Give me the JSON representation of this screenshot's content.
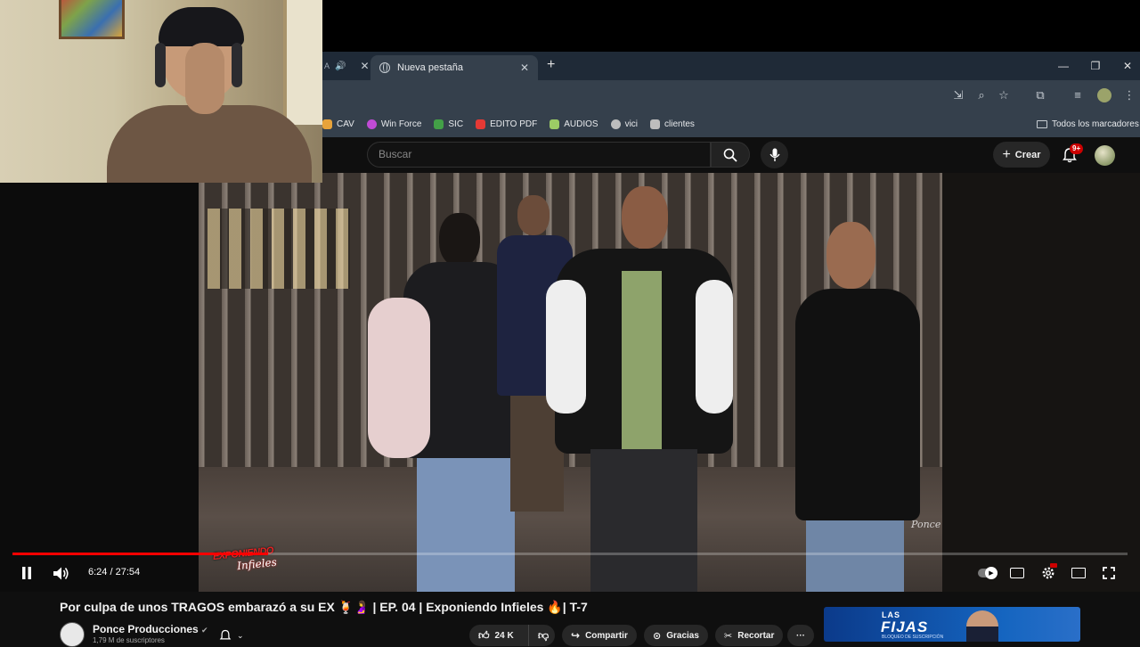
{
  "browser": {
    "prev_tab_label": "A",
    "active_tab_title": "Nueva pestaña",
    "new_tab_symbol": "+",
    "bookmarks": [
      {
        "label": "CAV",
        "color": "#e8a33a"
      },
      {
        "label": "Win Force",
        "color": "#c04bd6"
      },
      {
        "label": "SIC",
        "color": "#43a047"
      },
      {
        "label": "EDITO PDF",
        "color": "#e53935"
      },
      {
        "label": "AUDIOS",
        "color": "#9ccc65"
      },
      {
        "label": "vici",
        "color": "#bdbdbd"
      },
      {
        "label": "clientes",
        "color": "#bdbdbd"
      }
    ],
    "all_bookmarks_label": "Todos los marcadores"
  },
  "youtube": {
    "search_placeholder": "Buscar",
    "create_label": "Crear",
    "notification_count": "9+"
  },
  "player": {
    "current_time": "6:24",
    "duration": "27:54",
    "time_display": "6:24 / 27:54",
    "progress_fraction": 0.2294,
    "overlay_logo_line1": "EXPONIENDO",
    "overlay_logo_line2": "Infieles",
    "watermark": "Ponce"
  },
  "video_info": {
    "title": "Por culpa de unos TRAGOS embarazó a su EX 🍹🤰 | EP. 04 | Exponiendo Infieles 🔥| T-7",
    "channel_name": "Ponce Producciones",
    "subscribers": "1,79 M de suscriptores",
    "like_count": "24 K",
    "share_label": "Compartir",
    "thanks_label": "Gracias",
    "clip_label": "Recortar",
    "more_label": "···"
  },
  "ad": {
    "line1": "LAS",
    "line2": "FIJAS",
    "line3": "BLOQUEO DE SUSCRIPCIÓN"
  },
  "colors": {
    "progress": "#ff0000",
    "chrome_bg": "#35404c",
    "tab_strip": "#1f2a37",
    "yt_bg": "#0f0f0f"
  }
}
